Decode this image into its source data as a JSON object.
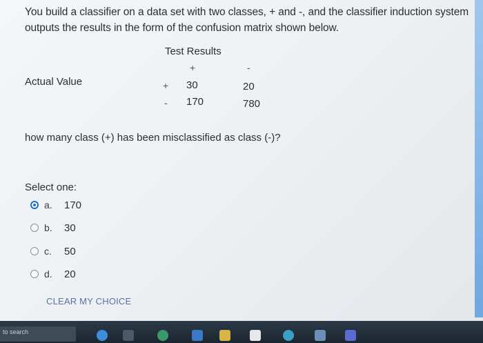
{
  "question": {
    "line1": "You build a classifier on a data set with two classes, + and -, and the classifier induction system",
    "line2": "outputs the results in the form of the confusion matrix shown below.",
    "prompt": "how many class (+) has been misclassified as class (-)?"
  },
  "matrix": {
    "title": "Test Results",
    "row_header": "Actual Value",
    "col_plus": "+",
    "col_minus": "-",
    "row_plus": "+",
    "row_minus": "-",
    "cells": {
      "pp": "30",
      "pm": "20",
      "mp": "170",
      "mm": "780"
    }
  },
  "answer": {
    "select_label": "Select one:",
    "options": [
      {
        "letter": "a.",
        "value": "170",
        "selected": true
      },
      {
        "letter": "b.",
        "value": "30",
        "selected": false
      },
      {
        "letter": "c.",
        "value": "50",
        "selected": false
      },
      {
        "letter": "d.",
        "value": "20",
        "selected": false
      }
    ],
    "clear_label": "CLEAR MY CHOICE"
  },
  "taskbar": {
    "search_text": "to search"
  },
  "colors": {
    "accent": "#1d6fd1",
    "link": "#5a6fa6",
    "taskbar": "#1c2630"
  }
}
